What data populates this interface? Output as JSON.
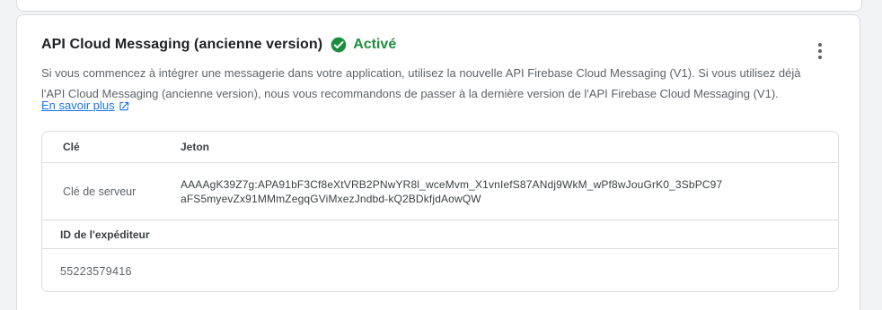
{
  "card": {
    "title": "API Cloud Messaging (ancienne version)",
    "status": "Activé",
    "description": "Si vous commencez à intégrer une messagerie dans votre application, utilisez la nouvelle API Firebase Cloud Messaging (V1). Si vous utilisez déjà l'API Cloud Messaging (ancienne version), nous vous recommandons de passer à la dernière version de l'API Firebase Cloud Messaging (V1).",
    "learn_more": "En savoir plus"
  },
  "table": {
    "headers": {
      "key": "Clé",
      "token": "Jeton"
    },
    "server_key_row": {
      "label": "Clé de serveur",
      "token_line1": "AAAAgK39Z7g:APA91bF3Cf8eXtVRB2PNwYR8l_wceMvm_X1vnIefS87ANdj9WkM_wPf8wJouGrK0_3SbPC97",
      "token_line2": "aFS5myevZx91MMmZegqGViMxezJndbd-kQ2BDkfjdAowQW"
    },
    "sender_section": {
      "label": "ID de l'expéditeur",
      "value": "55223579416"
    }
  },
  "icons": {
    "status": "check-circle-icon",
    "menu": "more-vert-icon",
    "external": "open-in-new-icon"
  },
  "colors": {
    "accent": "#1a73e8",
    "success": "#1e8e3e",
    "border": "#dadce0"
  }
}
